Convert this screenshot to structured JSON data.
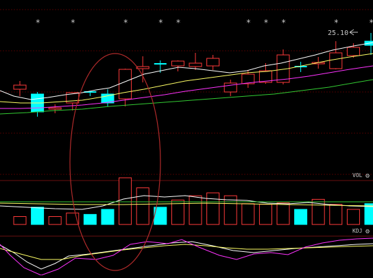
{
  "chart_data": [
    {
      "type": "candlestick",
      "pane": "price",
      "annotations": {
        "price_label": "25.10",
        "marker_symbol": "*"
      },
      "colors": {
        "up": "#ff3a3a",
        "down": "#00ffff",
        "background": "#000000",
        "grid": "#4a0000",
        "highlight": "#c0392b"
      },
      "candles": [
        {
          "open": 0.0,
          "high": 0.0,
          "low": 0.0,
          "close": 0.0,
          "dir": "up",
          "starred": false,
          "flat": false
        },
        {
          "open": 0.0,
          "high": 0.0,
          "low": 0.0,
          "close": 0.0,
          "dir": "down",
          "starred": true,
          "flat": false
        },
        {
          "open": 0.0,
          "high": 0.0,
          "low": 0.0,
          "close": 0.0,
          "dir": "up",
          "starred": false,
          "flat": false
        },
        {
          "open": 0.0,
          "high": 0.0,
          "low": 0.0,
          "close": 0.0,
          "dir": "up",
          "starred": true,
          "flat": false
        },
        {
          "open": 0.0,
          "high": 0.0,
          "low": 0.0,
          "close": 0.0,
          "dir": "down",
          "starred": false,
          "flat": true
        },
        {
          "open": 0.0,
          "high": 0.0,
          "low": 0.0,
          "close": 0.0,
          "dir": "down",
          "starred": false,
          "flat": false
        },
        {
          "open": 0.0,
          "high": 0.0,
          "low": 0.0,
          "close": 0.0,
          "dir": "up",
          "starred": true,
          "flat": false
        },
        {
          "open": 0.0,
          "high": 0.0,
          "low": 0.0,
          "close": 0.0,
          "dir": "up",
          "starred": false,
          "flat": false
        },
        {
          "open": 0.0,
          "high": 0.0,
          "low": 0.0,
          "close": 0.0,
          "dir": "down",
          "starred": true,
          "flat": true
        },
        {
          "open": 0.0,
          "high": 0.0,
          "low": 0.0,
          "close": 0.0,
          "dir": "up",
          "starred": true,
          "flat": false
        },
        {
          "open": 0.0,
          "high": 0.0,
          "low": 0.0,
          "close": 0.0,
          "dir": "up",
          "starred": false,
          "flat": false
        },
        {
          "open": 0.0,
          "high": 0.0,
          "low": 0.0,
          "close": 0.0,
          "dir": "up",
          "starred": false,
          "flat": false
        },
        {
          "open": 0.0,
          "high": 0.0,
          "low": 0.0,
          "close": 0.0,
          "dir": "up",
          "starred": false,
          "flat": false
        },
        {
          "open": 0.0,
          "high": 0.0,
          "low": 0.0,
          "close": 0.0,
          "dir": "up",
          "starred": true,
          "flat": false
        },
        {
          "open": 0.0,
          "high": 0.0,
          "low": 0.0,
          "close": 0.0,
          "dir": "up",
          "starred": true,
          "flat": false
        },
        {
          "open": 0.0,
          "high": 0.0,
          "low": 0.0,
          "close": 0.0,
          "dir": "up",
          "starred": true,
          "flat": false
        },
        {
          "open": 0.0,
          "high": 0.0,
          "low": 0.0,
          "close": 0.0,
          "dir": "down",
          "starred": false,
          "flat": true
        },
        {
          "open": 0.0,
          "high": 0.0,
          "low": 0.0,
          "close": 0.0,
          "dir": "up",
          "starred": false,
          "flat": false
        },
        {
          "open": 0.0,
          "high": 0.0,
          "low": 0.0,
          "close": 0.0,
          "dir": "up",
          "starred": true,
          "flat": false
        },
        {
          "open": 0.0,
          "high": 0.0,
          "low": 0.0,
          "close": 0.0,
          "dir": "up",
          "starred": false,
          "flat": false
        },
        {
          "open": 0.0,
          "high": 0.0,
          "low": 0.0,
          "close": 0.0,
          "dir": "down",
          "starred": true,
          "flat": false
        },
        {
          "open": 0.0,
          "high": 0.0,
          "low": 0.0,
          "close": 0.0,
          "dir": "up",
          "starred": false,
          "flat": false
        }
      ],
      "moving_averages": [
        {
          "color": "#ffffff",
          "values": []
        },
        {
          "color": "#ffff66",
          "values": []
        },
        {
          "color": "#ff33ff",
          "values": []
        },
        {
          "color": "#33cc33",
          "values": []
        }
      ]
    },
    {
      "type": "bar",
      "pane": "volume",
      "label": "VOL",
      "values": [
        11,
        24,
        11,
        16,
        14,
        21,
        65,
        51,
        24,
        34,
        40,
        44,
        40,
        29,
        28,
        30,
        21,
        35,
        28,
        21,
        29,
        18
      ],
      "colors": {
        "up": "#ff3a3a",
        "down": "#00ffff"
      },
      "moving_averages": [
        {
          "color": "#ffffff",
          "values": []
        },
        {
          "color": "#ffff66",
          "values": []
        }
      ]
    },
    {
      "type": "line",
      "pane": "kdj",
      "label": "KDJ",
      "series": [
        {
          "color": "#ffffff",
          "values": []
        },
        {
          "color": "#ffff66",
          "values": []
        },
        {
          "color": "#ff33ff",
          "values": []
        }
      ]
    }
  ]
}
